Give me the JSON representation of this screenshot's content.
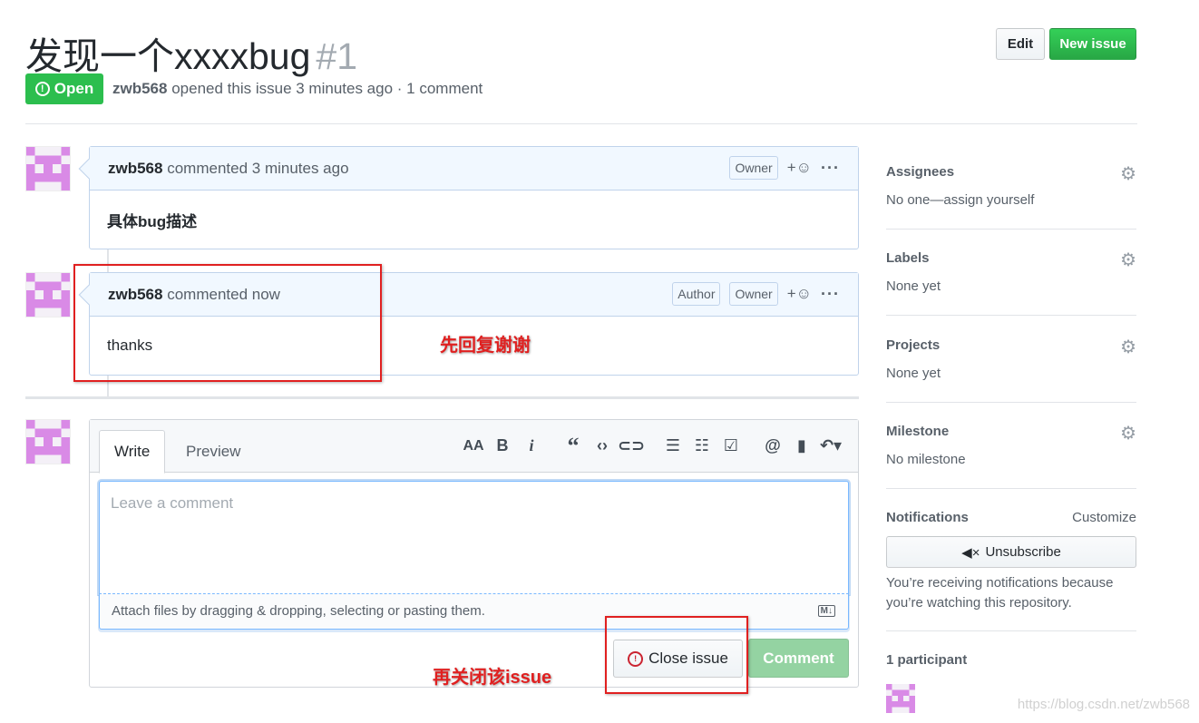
{
  "issue": {
    "title": "发现一个xxxxbug",
    "number": "#1",
    "state": "Open",
    "author": "zwb568",
    "meta_rest": "opened this issue 3 minutes ago · 1 comment"
  },
  "header_buttons": {
    "edit": "Edit",
    "new_issue": "New issue"
  },
  "comments": [
    {
      "author": "zwb568",
      "action": "commented 3 minutes ago",
      "tags": [
        "Owner"
      ],
      "react": "+☺",
      "body": "具体bug描述",
      "body_bold": true
    },
    {
      "author": "zwb568",
      "action": "commented now",
      "tags": [
        "Author",
        "Owner"
      ],
      "react": "+☺",
      "body": "thanks",
      "body_bold": false
    }
  ],
  "editor": {
    "tabs": [
      "Write",
      "Preview"
    ],
    "toolbar_icons": [
      "text-size-icon",
      "bold-icon",
      "italic-icon",
      "quote-icon",
      "code-icon",
      "link-icon",
      "bulleted-list-icon",
      "numbered-list-icon",
      "task-list-icon",
      "mention-icon",
      "saved-reply-icon",
      "reply-icon"
    ],
    "placeholder": "Leave a comment",
    "attach_text": "Attach files by dragging & dropping, selecting or pasting them.",
    "close_issue": "Close issue",
    "comment": "Comment"
  },
  "sidebar": {
    "assignees": {
      "label": "Assignees",
      "value": "No one—assign yourself"
    },
    "labels": {
      "label": "Labels",
      "value": "None yet"
    },
    "projects": {
      "label": "Projects",
      "value": "None yet"
    },
    "milestone": {
      "label": "Milestone",
      "value": "No milestone"
    },
    "notifications": {
      "label": "Notifications",
      "customize": "Customize",
      "unsubscribe": "Unsubscribe",
      "note": "You’re receiving notifications because you’re watching this repository."
    },
    "participants": "1 participant"
  },
  "annotations": {
    "reply_first": "先回复谢谢",
    "then_close": "再关闭该issue"
  },
  "watermark": "https://blog.csdn.net/zwb568",
  "colors": {
    "open_green": "#2cbe4e",
    "annotation_red": "#e02020",
    "comment_header": "#f1f8ff"
  }
}
